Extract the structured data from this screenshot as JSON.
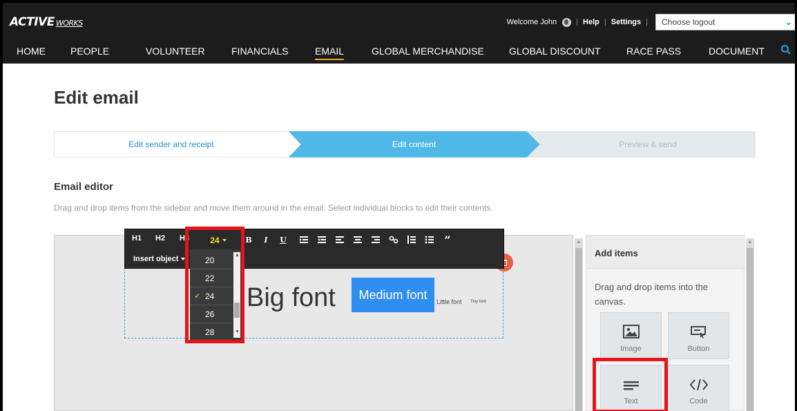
{
  "header": {
    "logo_main": "ACTIVE",
    "logo_sub": "WORKS",
    "welcome": "Welcome John",
    "help": "Help",
    "settings": "Settings",
    "logout_select": "Choose logout"
  },
  "nav": {
    "items": [
      "HOME",
      "PEOPLE",
      "VOLUNTEER",
      "FINANCIALS",
      "EMAIL",
      "GLOBAL MERCHANDISE",
      "GLOBAL DISCOUNT",
      "RACE PASS",
      "DOCUMENT"
    ],
    "active": "EMAIL"
  },
  "page": {
    "title": "Edit email"
  },
  "steps": [
    {
      "label": "Edit sender and receipt",
      "state": "done"
    },
    {
      "label": "Edit content",
      "state": "active"
    },
    {
      "label": "Preview & send",
      "state": "pending"
    }
  ],
  "editor": {
    "label": "Email editor",
    "description": "Drag and drop items from the sidebar and move them around in the email. Select individual blocks to edit their contents."
  },
  "toolbar": {
    "h1": "H1",
    "h2": "H2",
    "h3": "H3",
    "font_size": "24",
    "bold": "B",
    "italic": "I",
    "underline": "U",
    "insert_object": "Insert object",
    "font_size_options": [
      "20",
      "22",
      "24",
      "26",
      "28"
    ],
    "selected_font_size": "24"
  },
  "content": {
    "big": "Big font",
    "medium": "Medium font",
    "little": "Little font",
    "tiny": "Tiny font"
  },
  "sidebar": {
    "title": "Add items",
    "description": "Drag and drop items into the canvas.",
    "tiles": [
      "Image",
      "Button",
      "Text",
      "Code"
    ]
  },
  "colors": {
    "accent_blue": "#4fb8e6",
    "highlight_red": "#e5141b",
    "nav_underline": "#f0a830",
    "selection_blue": "#2f8ef0"
  }
}
